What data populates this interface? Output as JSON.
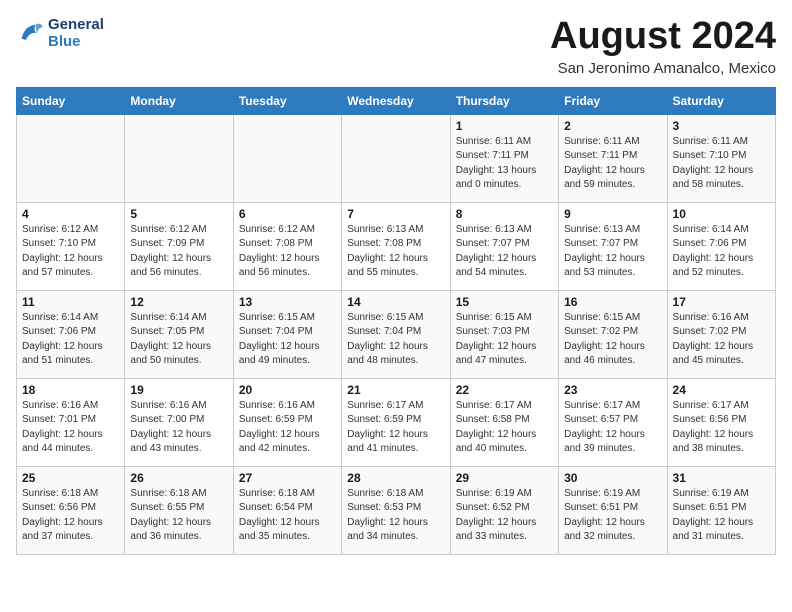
{
  "header": {
    "logo_line1": "General",
    "logo_line2": "Blue",
    "month_year": "August 2024",
    "location": "San Jeronimo Amanalco, Mexico"
  },
  "days_of_week": [
    "Sunday",
    "Monday",
    "Tuesday",
    "Wednesday",
    "Thursday",
    "Friday",
    "Saturday"
  ],
  "weeks": [
    [
      {
        "day": "",
        "info": ""
      },
      {
        "day": "",
        "info": ""
      },
      {
        "day": "",
        "info": ""
      },
      {
        "day": "",
        "info": ""
      },
      {
        "day": "1",
        "info": "Sunrise: 6:11 AM\nSunset: 7:11 PM\nDaylight: 13 hours\nand 0 minutes."
      },
      {
        "day": "2",
        "info": "Sunrise: 6:11 AM\nSunset: 7:11 PM\nDaylight: 12 hours\nand 59 minutes."
      },
      {
        "day": "3",
        "info": "Sunrise: 6:11 AM\nSunset: 7:10 PM\nDaylight: 12 hours\nand 58 minutes."
      }
    ],
    [
      {
        "day": "4",
        "info": "Sunrise: 6:12 AM\nSunset: 7:10 PM\nDaylight: 12 hours\nand 57 minutes."
      },
      {
        "day": "5",
        "info": "Sunrise: 6:12 AM\nSunset: 7:09 PM\nDaylight: 12 hours\nand 56 minutes."
      },
      {
        "day": "6",
        "info": "Sunrise: 6:12 AM\nSunset: 7:08 PM\nDaylight: 12 hours\nand 56 minutes."
      },
      {
        "day": "7",
        "info": "Sunrise: 6:13 AM\nSunset: 7:08 PM\nDaylight: 12 hours\nand 55 minutes."
      },
      {
        "day": "8",
        "info": "Sunrise: 6:13 AM\nSunset: 7:07 PM\nDaylight: 12 hours\nand 54 minutes."
      },
      {
        "day": "9",
        "info": "Sunrise: 6:13 AM\nSunset: 7:07 PM\nDaylight: 12 hours\nand 53 minutes."
      },
      {
        "day": "10",
        "info": "Sunrise: 6:14 AM\nSunset: 7:06 PM\nDaylight: 12 hours\nand 52 minutes."
      }
    ],
    [
      {
        "day": "11",
        "info": "Sunrise: 6:14 AM\nSunset: 7:06 PM\nDaylight: 12 hours\nand 51 minutes."
      },
      {
        "day": "12",
        "info": "Sunrise: 6:14 AM\nSunset: 7:05 PM\nDaylight: 12 hours\nand 50 minutes."
      },
      {
        "day": "13",
        "info": "Sunrise: 6:15 AM\nSunset: 7:04 PM\nDaylight: 12 hours\nand 49 minutes."
      },
      {
        "day": "14",
        "info": "Sunrise: 6:15 AM\nSunset: 7:04 PM\nDaylight: 12 hours\nand 48 minutes."
      },
      {
        "day": "15",
        "info": "Sunrise: 6:15 AM\nSunset: 7:03 PM\nDaylight: 12 hours\nand 47 minutes."
      },
      {
        "day": "16",
        "info": "Sunrise: 6:15 AM\nSunset: 7:02 PM\nDaylight: 12 hours\nand 46 minutes."
      },
      {
        "day": "17",
        "info": "Sunrise: 6:16 AM\nSunset: 7:02 PM\nDaylight: 12 hours\nand 45 minutes."
      }
    ],
    [
      {
        "day": "18",
        "info": "Sunrise: 6:16 AM\nSunset: 7:01 PM\nDaylight: 12 hours\nand 44 minutes."
      },
      {
        "day": "19",
        "info": "Sunrise: 6:16 AM\nSunset: 7:00 PM\nDaylight: 12 hours\nand 43 minutes."
      },
      {
        "day": "20",
        "info": "Sunrise: 6:16 AM\nSunset: 6:59 PM\nDaylight: 12 hours\nand 42 minutes."
      },
      {
        "day": "21",
        "info": "Sunrise: 6:17 AM\nSunset: 6:59 PM\nDaylight: 12 hours\nand 41 minutes."
      },
      {
        "day": "22",
        "info": "Sunrise: 6:17 AM\nSunset: 6:58 PM\nDaylight: 12 hours\nand 40 minutes."
      },
      {
        "day": "23",
        "info": "Sunrise: 6:17 AM\nSunset: 6:57 PM\nDaylight: 12 hours\nand 39 minutes."
      },
      {
        "day": "24",
        "info": "Sunrise: 6:17 AM\nSunset: 6:56 PM\nDaylight: 12 hours\nand 38 minutes."
      }
    ],
    [
      {
        "day": "25",
        "info": "Sunrise: 6:18 AM\nSunset: 6:56 PM\nDaylight: 12 hours\nand 37 minutes."
      },
      {
        "day": "26",
        "info": "Sunrise: 6:18 AM\nSunset: 6:55 PM\nDaylight: 12 hours\nand 36 minutes."
      },
      {
        "day": "27",
        "info": "Sunrise: 6:18 AM\nSunset: 6:54 PM\nDaylight: 12 hours\nand 35 minutes."
      },
      {
        "day": "28",
        "info": "Sunrise: 6:18 AM\nSunset: 6:53 PM\nDaylight: 12 hours\nand 34 minutes."
      },
      {
        "day": "29",
        "info": "Sunrise: 6:19 AM\nSunset: 6:52 PM\nDaylight: 12 hours\nand 33 minutes."
      },
      {
        "day": "30",
        "info": "Sunrise: 6:19 AM\nSunset: 6:51 PM\nDaylight: 12 hours\nand 32 minutes."
      },
      {
        "day": "31",
        "info": "Sunrise: 6:19 AM\nSunset: 6:51 PM\nDaylight: 12 hours\nand 31 minutes."
      }
    ]
  ]
}
